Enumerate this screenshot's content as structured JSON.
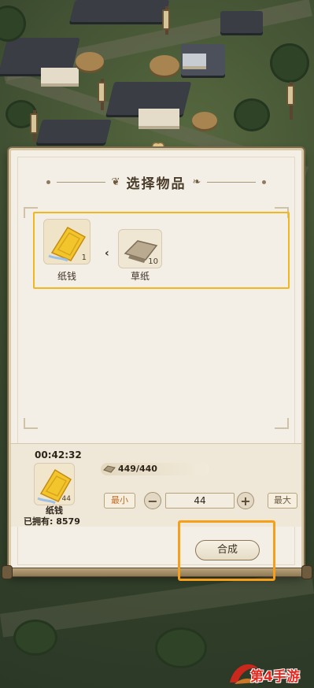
{
  "dialog": {
    "title": "选择物品"
  },
  "recipe": {
    "selected_item": {
      "name": "纸钱",
      "count": "1",
      "icon": "paper-money-icon"
    },
    "ingredient": {
      "name": "草纸",
      "count": "10",
      "icon": "straw-paper-icon"
    }
  },
  "craft": {
    "timer": "00:42:32",
    "product_name": "纸钱",
    "product_count": "44",
    "owned": "已拥有: 8579",
    "material_amount": "449/440",
    "min_label": "最小",
    "max_label": "最大",
    "quantity": "44",
    "synth_label": "合成"
  },
  "watermark": {
    "text": "第4手游"
  },
  "colors": {
    "highlight": "#f1b71c",
    "panel": "#f4efe6",
    "accent_orange": "#f5a018",
    "min_text": "#c06b24"
  }
}
